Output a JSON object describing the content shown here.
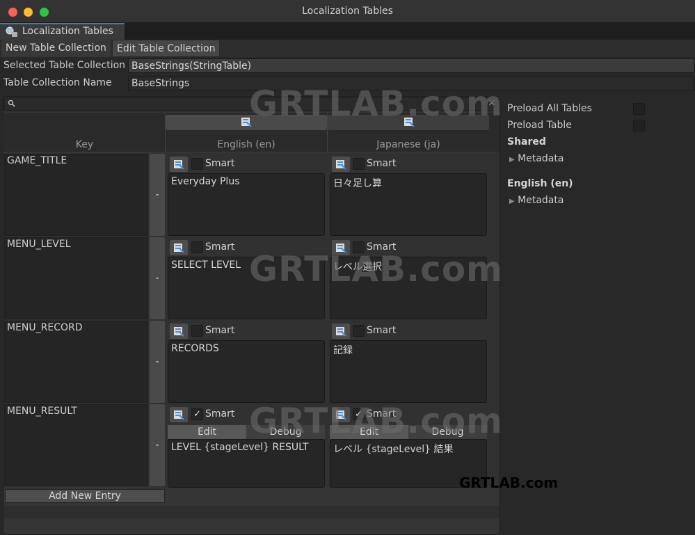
{
  "window": {
    "title": "Localization Tables"
  },
  "window_tab": {
    "label": "Localization Tables"
  },
  "toolbar": {
    "new_label": "New Table Collection",
    "edit_label": "Edit Table Collection"
  },
  "fields": {
    "selected_label": "Selected Table Collection",
    "selected_value": "BaseStrings(StringTable)",
    "name_label": "Table Collection Name",
    "name_value": "BaseStrings"
  },
  "table": {
    "search": {
      "close_glyph": "×"
    },
    "headers": {
      "key": "Key",
      "lang1": "English (en)",
      "lang2": "Japanese (ja)"
    },
    "smart_label": "Smart",
    "remove_label": "-",
    "edit_label": "Edit",
    "debug_label": "Debug",
    "rows": [
      {
        "key": "GAME_TITLE",
        "en": "Everyday Plus",
        "ja": "日々足し算",
        "en_smart": false,
        "ja_smart": false
      },
      {
        "key": "MENU_LEVEL",
        "en": "SELECT LEVEL",
        "ja": "レベル選択",
        "en_smart": false,
        "ja_smart": false
      },
      {
        "key": "MENU_RECORD",
        "en": "RECORDS",
        "ja": "記録",
        "en_smart": false,
        "ja_smart": false
      },
      {
        "key": "MENU_RESULT",
        "en": "LEVEL {stageLevel} RESULT",
        "ja": "レベル {stageLevel} 結果",
        "en_smart": true,
        "ja_smart": true
      }
    ],
    "add_entry_label": "Add New Entry"
  },
  "right_panel": {
    "preload_all_label": "Preload All Tables",
    "preload_table_label": "Preload Table",
    "shared_label": "Shared",
    "metadata_label": "Metadata",
    "english_label": "English (en)"
  },
  "watermark": {
    "big": "GRTLAB.com",
    "small": "GRTLAB.com"
  },
  "icons": {
    "traffic_lights": [
      "close-icon",
      "minimize-icon",
      "zoom-icon"
    ],
    "table_icon": "string-table-icon",
    "search": "search-icon",
    "expand": "triangle-right-icon"
  },
  "colors": {
    "close": "#ff5f57",
    "minimize": "#febc2e",
    "zoom": "#28c840",
    "tab_accent": "#3c78c4",
    "table_icon_blue": "#4a8fd8"
  }
}
